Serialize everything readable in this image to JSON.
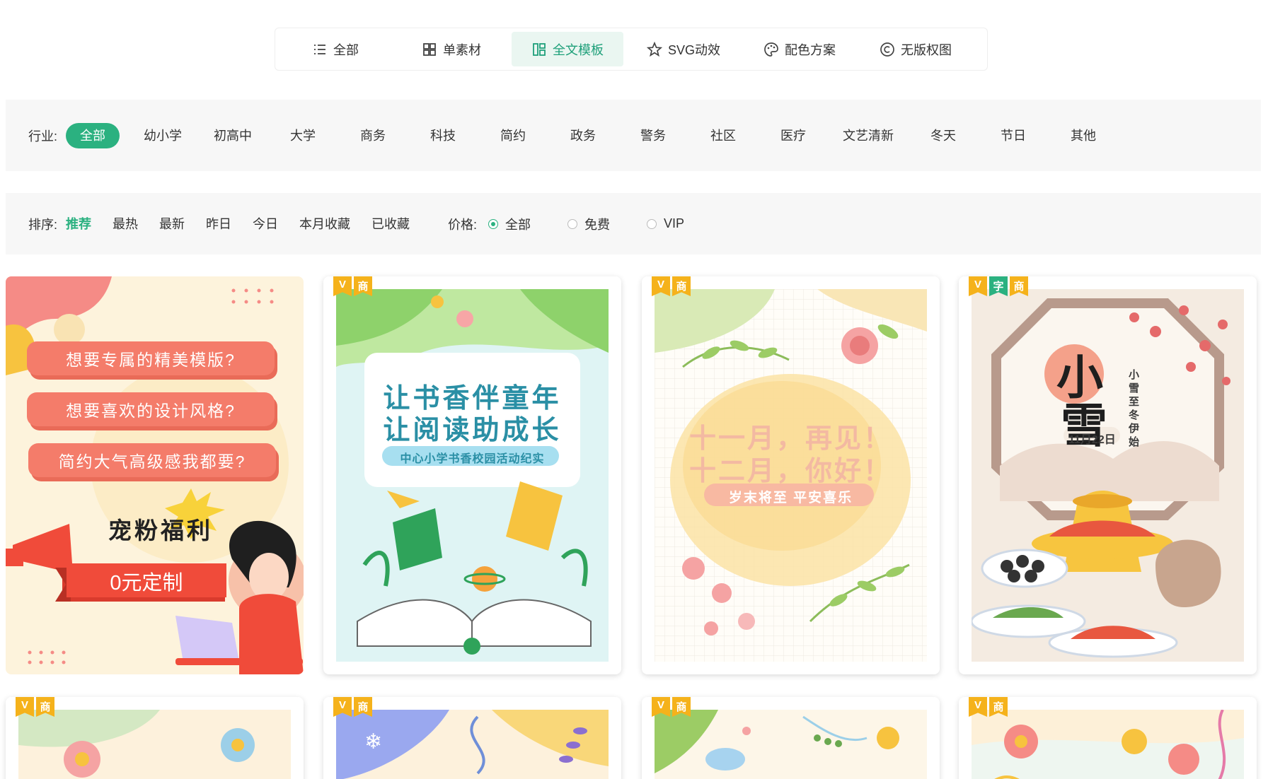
{
  "tabs": [
    {
      "label": "全部",
      "icon": "list-icon",
      "active": false
    },
    {
      "label": "单素材",
      "icon": "grid-icon",
      "active": false
    },
    {
      "label": "全文模板",
      "icon": "template-icon",
      "active": true
    },
    {
      "label": "SVG动效",
      "icon": "star-icon",
      "active": false
    },
    {
      "label": "配色方案",
      "icon": "palette-icon",
      "active": false
    },
    {
      "label": "无版权图",
      "icon": "copyright-icon",
      "active": false
    }
  ],
  "industry": {
    "label": "行业:",
    "items": [
      "全部",
      "幼小学",
      "初高中",
      "大学",
      "商务",
      "科技",
      "简约",
      "政务",
      "警务",
      "社区",
      "医疗",
      "文艺清新",
      "冬天",
      "节日",
      "其他"
    ],
    "active_index": 0
  },
  "sort": {
    "label": "排序:",
    "items": [
      "推荐",
      "最热",
      "最新",
      "昨日",
      "今日",
      "本月收藏",
      "已收藏"
    ],
    "active_index": 0
  },
  "price": {
    "label": "价格:",
    "options": [
      "全部",
      "免费",
      "VIP"
    ],
    "selected_index": 0
  },
  "promo_card": {
    "lines": [
      "想要专属的精美模版?",
      "想要喜欢的设计风格?",
      "简约大气高级感我都要?"
    ],
    "headline": "宠粉福利",
    "cta": "0元定制"
  },
  "cards": [
    {
      "badges": [
        "V",
        "商"
      ],
      "title1": "让书香伴童年",
      "title2": "让阅读助成长",
      "subtitle": "中心小学书香校园活动纪实"
    },
    {
      "badges": [
        "V",
        "商"
      ],
      "title1": "十一月，再见！",
      "title2": "十二月，你好！",
      "subtitle": "岁末将至 平安喜乐"
    },
    {
      "badges": [
        "V",
        "字",
        "商"
      ],
      "title1": "小",
      "title2": "雪",
      "side": "小雪至冬伊始",
      "date": "11月22日"
    },
    {
      "badges": [
        "V",
        "商"
      ]
    },
    {
      "badges": [
        "V",
        "商"
      ]
    },
    {
      "badges": [
        "V",
        "商"
      ]
    },
    {
      "badges": [
        "V",
        "商"
      ]
    }
  ],
  "colors": {
    "accent": "#2bb180",
    "badge_gold": "#f5b21b",
    "promo_red": "#f47c6a"
  }
}
